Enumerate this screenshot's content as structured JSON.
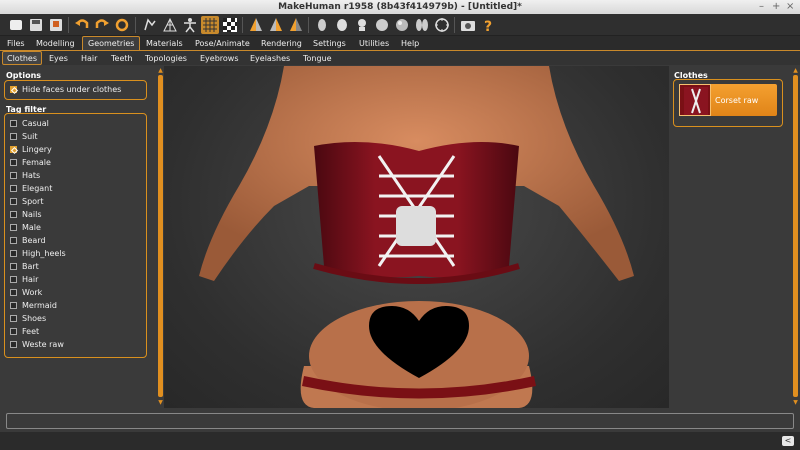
{
  "window": {
    "title": "MakeHuman r1958 (8b43f414979b) - [Untitled]*",
    "controls": {
      "minimize": "–",
      "maximize": "+",
      "close": "×"
    }
  },
  "toolbar": {
    "icons": [
      "new-file-icon",
      "save-icon",
      "export-icon",
      "undo-icon",
      "redo-icon",
      "reset-icon",
      "smooth-icon",
      "wireframe-icon",
      "pose-icon",
      "grid-icon",
      "checker-icon",
      "front-view-icon",
      "back-view-icon",
      "left-view-icon",
      "right-view-icon",
      "top-view-icon",
      "bottom-view-icon",
      "reset-camera-icon",
      "screenshot-icon",
      "help-icon"
    ]
  },
  "menu_tabs": [
    "Files",
    "Modelling",
    "Geometries",
    "Materials",
    "Pose/Animate",
    "Rendering",
    "Settings",
    "Utilities",
    "Help"
  ],
  "active_menu_tab": "Geometries",
  "sub_tabs": [
    "Clothes",
    "Eyes",
    "Hair",
    "Teeth",
    "Topologies",
    "Eyebrows",
    "Eyelashes",
    "Tongue"
  ],
  "active_sub_tab": "Clothes",
  "options": {
    "title": "Options",
    "hide_faces_label": "Hide faces under clothes",
    "hide_faces_checked": true
  },
  "tag_filter": {
    "title": "Tag filter",
    "items": [
      {
        "label": "Casual",
        "checked": false
      },
      {
        "label": "Suit",
        "checked": false
      },
      {
        "label": "Lingery",
        "checked": true
      },
      {
        "label": "Female",
        "checked": false
      },
      {
        "label": "Hats",
        "checked": false
      },
      {
        "label": "Elegant",
        "checked": false
      },
      {
        "label": "Sport",
        "checked": false
      },
      {
        "label": "Nails",
        "checked": false
      },
      {
        "label": "Male",
        "checked": false
      },
      {
        "label": "Beard",
        "checked": false
      },
      {
        "label": "High_heels",
        "checked": false
      },
      {
        "label": "Bart",
        "checked": false
      },
      {
        "label": "Hair",
        "checked": false
      },
      {
        "label": "Work",
        "checked": false
      },
      {
        "label": "Mermaid",
        "checked": false
      },
      {
        "label": "Shoes",
        "checked": false
      },
      {
        "label": "Feet",
        "checked": false
      },
      {
        "label": "Weste raw",
        "checked": false
      }
    ]
  },
  "clothes_panel": {
    "title": "Clothes",
    "items": [
      {
        "label": "Corset raw",
        "selected": true
      }
    ]
  },
  "colors": {
    "accent": "#e08f20",
    "background": "#3a3a3a",
    "corset": "#7a1015",
    "skin": "#c07850"
  }
}
